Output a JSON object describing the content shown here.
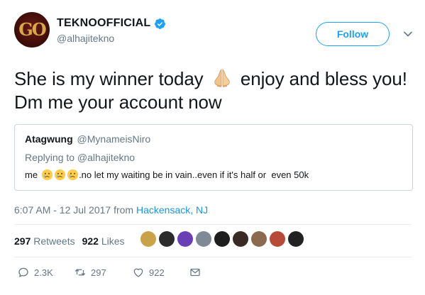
{
  "author": {
    "avatar_text": "GO",
    "display_name": "TEKNOOFFICIAL",
    "handle": "@alhajitekno",
    "verified_icon": "verified-badge-icon"
  },
  "follow_button": "Follow",
  "tweet": {
    "text_before_emoji": "She is my winner today",
    "emoji": "folded-hands-icon",
    "text_after_emoji": "enjoy and bless you! Dm me your account now"
  },
  "quote": {
    "name": "Atagwung",
    "handle": "@MynameisNiro",
    "replying_to": "Replying to @alhajitekno",
    "text_start": "me",
    "text_rest": ".no let my waiting be in vain..even if it's half or  even 50k"
  },
  "meta": {
    "time": "6:07 AM - 12 Jul 2017 from ",
    "location": "Hackensack, NJ"
  },
  "stats": {
    "retweets_count": "297",
    "retweets_label": "Retweets",
    "likes_count": "922",
    "likes_label": "Likes"
  },
  "likers": [
    "#c9a24a",
    "#2b2b2b",
    "#6a3fb5",
    "#7e8a96",
    "#1e1e1e",
    "#3a2a24",
    "#8c6a50",
    "#b84a3a",
    "#222222"
  ],
  "actions": {
    "reply_count": "2.3K",
    "retweet_count": "297",
    "like_count": "922"
  },
  "colors": {
    "accent": "#1da1f2",
    "link": "#1b95e0",
    "muted": "#657786",
    "border": "#ccd6dd"
  }
}
